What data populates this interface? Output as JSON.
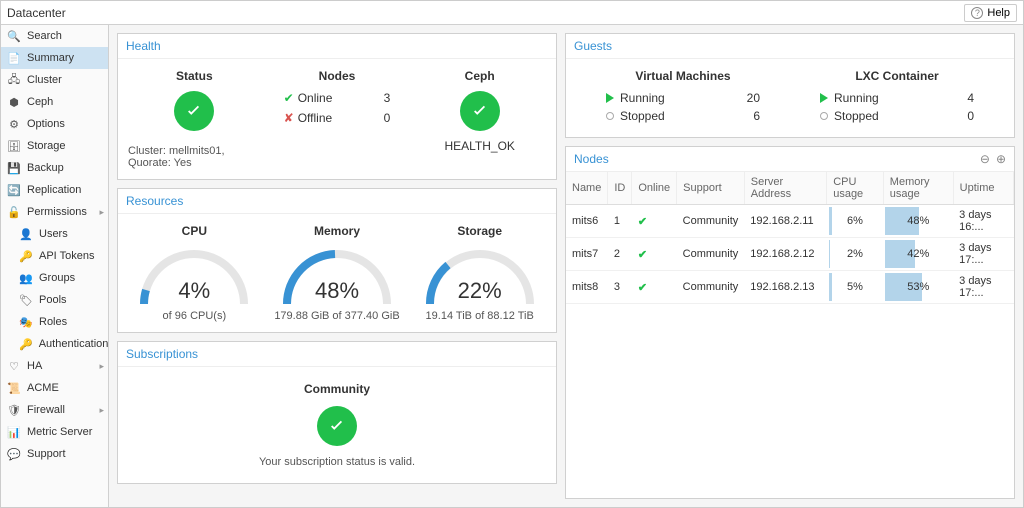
{
  "header": {
    "title": "Datacenter",
    "help_label": "Help"
  },
  "sidebar": {
    "items": [
      {
        "label": "Search",
        "icon": "search",
        "sel": false
      },
      {
        "label": "Summary",
        "icon": "summary",
        "sel": true
      },
      {
        "label": "Cluster",
        "icon": "cluster",
        "sel": false
      },
      {
        "label": "Ceph",
        "icon": "ceph",
        "sel": false
      },
      {
        "label": "Options",
        "icon": "options",
        "sel": false
      },
      {
        "label": "Storage",
        "icon": "storage",
        "sel": false
      },
      {
        "label": "Backup",
        "icon": "backup",
        "sel": false
      },
      {
        "label": "Replication",
        "icon": "replication",
        "sel": false
      },
      {
        "label": "Permissions",
        "icon": "permissions",
        "sel": false,
        "expand": true
      },
      {
        "label": "Users",
        "icon": "users",
        "sel": false,
        "child": true
      },
      {
        "label": "API Tokens",
        "icon": "tokens",
        "sel": false,
        "child": true
      },
      {
        "label": "Groups",
        "icon": "groups",
        "sel": false,
        "child": true
      },
      {
        "label": "Pools",
        "icon": "pools",
        "sel": false,
        "child": true
      },
      {
        "label": "Roles",
        "icon": "roles",
        "sel": false,
        "child": true
      },
      {
        "label": "Authentication",
        "icon": "auth",
        "sel": false,
        "child": true
      },
      {
        "label": "HA",
        "icon": "ha",
        "sel": false,
        "expand": true
      },
      {
        "label": "ACME",
        "icon": "acme",
        "sel": false
      },
      {
        "label": "Firewall",
        "icon": "firewall",
        "sel": false,
        "expand": true
      },
      {
        "label": "Metric Server",
        "icon": "metric",
        "sel": false
      },
      {
        "label": "Support",
        "icon": "support",
        "sel": false
      }
    ]
  },
  "health": {
    "title": "Health",
    "status_label": "Status",
    "nodes_label": "Nodes",
    "ceph_label": "Ceph",
    "online_label": "Online",
    "offline_label": "Offline",
    "online_count": "3",
    "offline_count": "0",
    "ceph_status": "HEALTH_OK",
    "cluster_info": "Cluster: mellmits01, Quorate: Yes"
  },
  "guests": {
    "title": "Guests",
    "vm_label": "Virtual Machines",
    "lxc_label": "LXC Container",
    "running_label": "Running",
    "stopped_label": "Stopped",
    "vm_running": "20",
    "vm_stopped": "6",
    "lxc_running": "4",
    "lxc_stopped": "0"
  },
  "resources": {
    "title": "Resources",
    "cpu_label": "CPU",
    "mem_label": "Memory",
    "storage_label": "Storage",
    "cpu_pct": "4%",
    "cpu_sub": "of 96 CPU(s)",
    "mem_pct": "48%",
    "mem_sub": "179.88 GiB of 377.40 GiB",
    "storage_pct": "22%",
    "storage_sub": "19.14 TiB of 88.12 TiB"
  },
  "nodes_panel": {
    "title": "Nodes",
    "cols": {
      "name": "Name",
      "id": "ID",
      "online": "Online",
      "support": "Support",
      "addr": "Server Address",
      "cpu": "CPU usage",
      "mem": "Memory usage",
      "uptime": "Uptime"
    },
    "rows": [
      {
        "name": "mits6",
        "id": "1",
        "support": "Community",
        "addr": "192.168.2.11",
        "cpu": "6%",
        "cpu_n": 6,
        "mem": "48%",
        "mem_n": 48,
        "uptime": "3 days 16:..."
      },
      {
        "name": "mits7",
        "id": "2",
        "support": "Community",
        "addr": "192.168.2.12",
        "cpu": "2%",
        "cpu_n": 2,
        "mem": "42%",
        "mem_n": 42,
        "uptime": "3 days 17:..."
      },
      {
        "name": "mits8",
        "id": "3",
        "support": "Community",
        "addr": "192.168.2.13",
        "cpu": "5%",
        "cpu_n": 5,
        "mem": "53%",
        "mem_n": 53,
        "uptime": "3 days 17:..."
      }
    ]
  },
  "subscriptions": {
    "title": "Subscriptions",
    "level": "Community",
    "status": "Your subscription status is valid."
  }
}
